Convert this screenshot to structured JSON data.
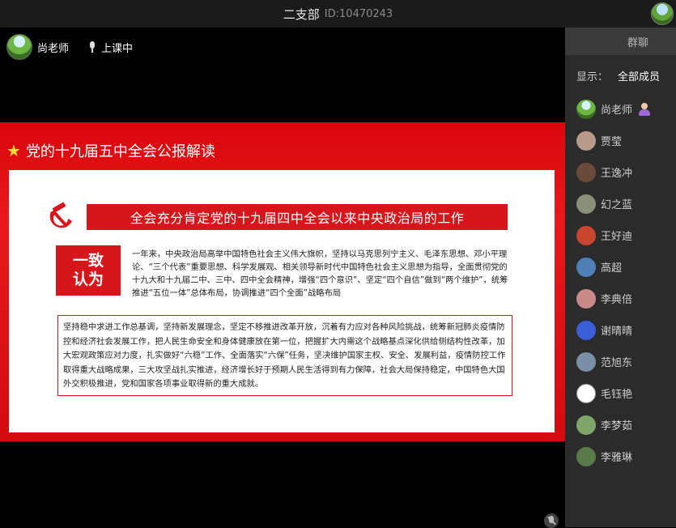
{
  "header": {
    "room_title": "二支部",
    "room_id": "ID:10470243"
  },
  "teacher_bar": {
    "name": "尚老师",
    "status": "上课中"
  },
  "slide": {
    "title": "党的十九届五中全会公报解读",
    "heading": "全会充分肯定党的十九届四中全会以来中央政治局的工作",
    "badge_line1": "一致",
    "badge_line2": "认为",
    "paragraph1": "一年来，中央政治局高举中国特色社会主义伟大旗帜，坚持以马克思列宁主义、毛泽东思想、邓小平理论、“三个代表”重要思想、科学发展观、相关领导新时代中国特色社会主义思想为指导，全面贯彻党的十九大和十九届二中、三中、四中全会精神，增强“四个意识”、坚定“四个自信”做到“两个维护”，统筹推进“五位一体”总体布局，协调推进“四个全面”战略布局",
    "paragraph2": "坚持稳中求进工作总基调，坚持新发展理念，坚定不移推进改革开放，沉着有力应对各种风险挑战，统筹新冠肺炎疫情防控和经济社会发展工作，把人民生命安全和身体健康放在第一位，把握扩大内需这个战略基点深化供给侧结构性改革，加大宏观政策应对力度，扎实做好“六稳”工作、全面落实“六保”任务，坚决维护国家主权、安全、发展利益，疫情防控工作取得重大战略成果，三大攻坚战扎实推进，经济增长好于预期人民生活得到有力保障，社会大局保持稳定，中国特色大国外交积极推进，党和国家各项事业取得新的重大成就。"
  },
  "sidebar": {
    "tab_label": "群聊",
    "filter_label": "显示：",
    "filter_value": "全部成员",
    "members": [
      {
        "name": "尚老师",
        "color": "#6db845"
      },
      {
        "name": "贾莹",
        "color": "#b89a8a"
      },
      {
        "name": "王逸冲",
        "color": "#6a4a3a"
      },
      {
        "name": "幻之蓝",
        "color": "#8a8f7a"
      },
      {
        "name": "王好迪",
        "color": "#c8452f"
      },
      {
        "name": "高超",
        "color": "#4f7fb5"
      },
      {
        "name": "李典倍",
        "color": "#c98a8a"
      },
      {
        "name": "谢晴晴",
        "color": "#3a5fd9"
      },
      {
        "name": "范旭东",
        "color": "#7a8fa5"
      },
      {
        "name": "毛钰艳",
        "color": "#ffffff"
      },
      {
        "name": "李梦茹",
        "color": "#7fa56a"
      },
      {
        "name": "李雅琳",
        "color": "#5a7a4a"
      }
    ]
  },
  "icons": [
    "star-icon",
    "hammer-sickle-icon",
    "microphone-icon",
    "mic-off-icon",
    "teacher-icon"
  ],
  "colors": {
    "accent_red": "#d7161b",
    "panel_bg": "#2b2b2b",
    "topbar_bg": "#1b1b1b"
  }
}
